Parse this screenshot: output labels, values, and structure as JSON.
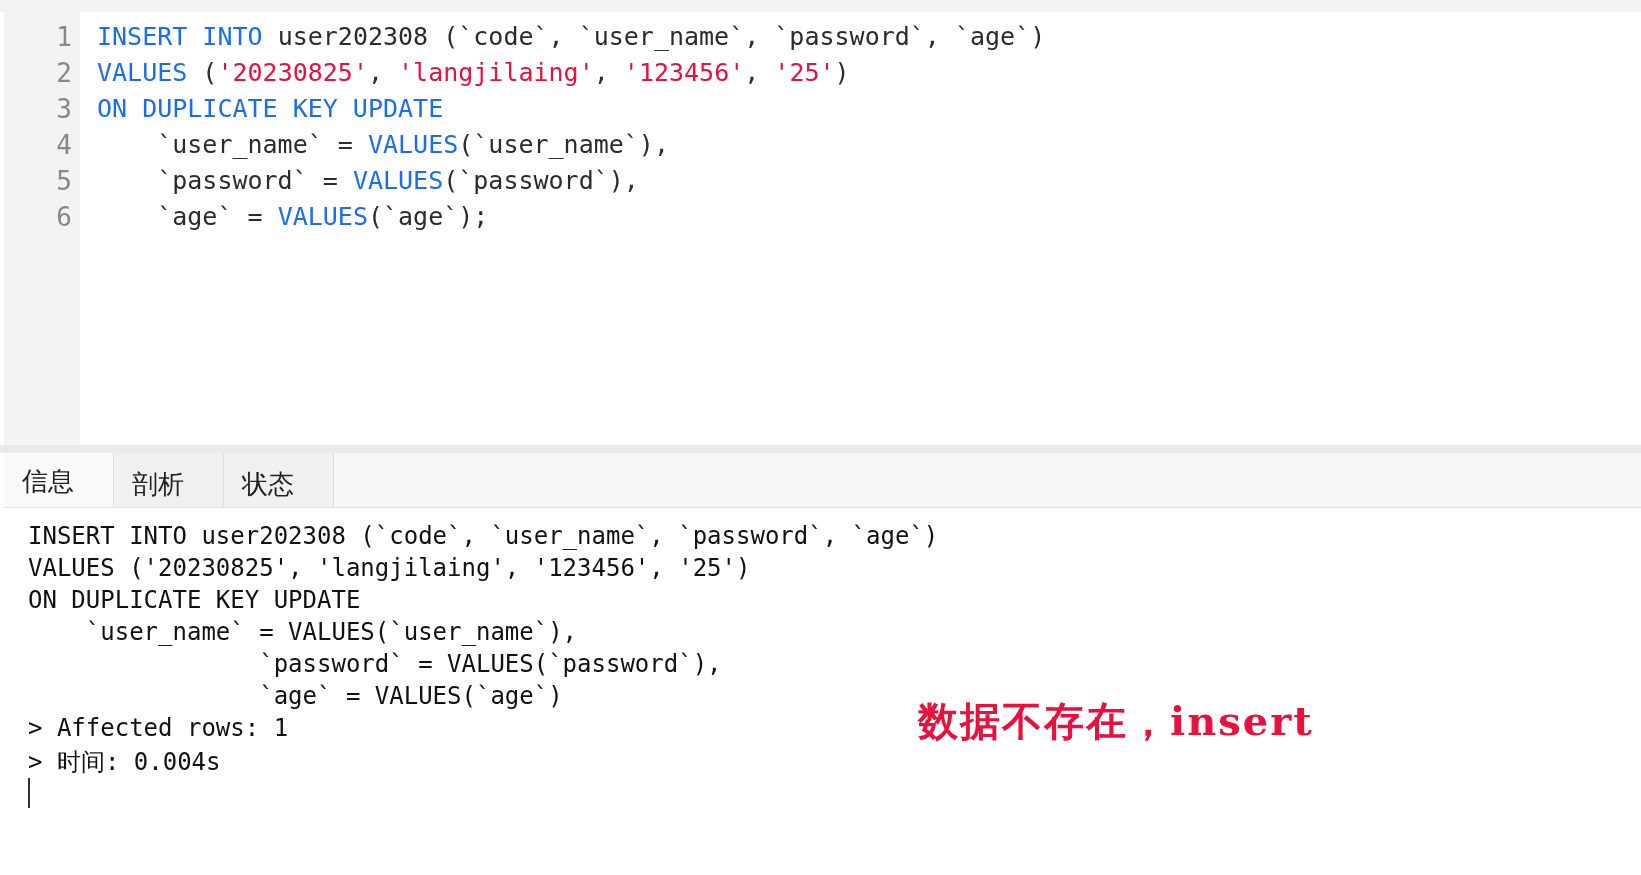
{
  "editor": {
    "lines": [
      {
        "number": "1",
        "tokens": [
          {
            "text": "INSERT INTO",
            "kind": "keyword"
          },
          {
            "text": " user202308 (`code`, `user_name`, `password`, `age`)",
            "kind": "plain"
          }
        ]
      },
      {
        "number": "2",
        "tokens": [
          {
            "text": "VALUES",
            "kind": "keyword"
          },
          {
            "text": " (",
            "kind": "plain"
          },
          {
            "text": "'20230825'",
            "kind": "string"
          },
          {
            "text": ", ",
            "kind": "plain"
          },
          {
            "text": "'langjilaing'",
            "kind": "string"
          },
          {
            "text": ", ",
            "kind": "plain"
          },
          {
            "text": "'123456'",
            "kind": "string"
          },
          {
            "text": ", ",
            "kind": "plain"
          },
          {
            "text": "'25'",
            "kind": "string"
          },
          {
            "text": ")",
            "kind": "plain"
          }
        ]
      },
      {
        "number": "3",
        "tokens": [
          {
            "text": "ON DUPLICATE KEY UPDATE",
            "kind": "keyword"
          }
        ]
      },
      {
        "number": "4",
        "tokens": [
          {
            "text": "    `user_name` = ",
            "kind": "plain"
          },
          {
            "text": "VALUES",
            "kind": "keyword"
          },
          {
            "text": "(`user_name`),",
            "kind": "plain"
          }
        ]
      },
      {
        "number": "5",
        "tokens": [
          {
            "text": "    `password` = ",
            "kind": "plain"
          },
          {
            "text": "VALUES",
            "kind": "keyword"
          },
          {
            "text": "(`password`),",
            "kind": "plain"
          }
        ]
      },
      {
        "number": "6",
        "tokens": [
          {
            "text": "    `age` = ",
            "kind": "plain"
          },
          {
            "text": "VALUES",
            "kind": "keyword"
          },
          {
            "text": "(`age`);",
            "kind": "plain"
          }
        ]
      }
    ]
  },
  "tabs": [
    {
      "label": "信息",
      "selected": true
    },
    {
      "label": "剖析",
      "selected": false
    },
    {
      "label": "状态",
      "selected": false
    }
  ],
  "output": {
    "lines": [
      "INSERT INTO user202308 (`code`, `user_name`, `password`, `age`)",
      "VALUES ('20230825', 'langjilaing', '123456', '25')",
      "ON DUPLICATE KEY UPDATE",
      "    `user_name` = VALUES(`user_name`),",
      "                `password` = VALUES(`password`),",
      "                `age` = VALUES(`age`)",
      "> Affected rows: 1",
      "> 时间: 0.004s"
    ],
    "annotation": "数据不存在，insert"
  }
}
